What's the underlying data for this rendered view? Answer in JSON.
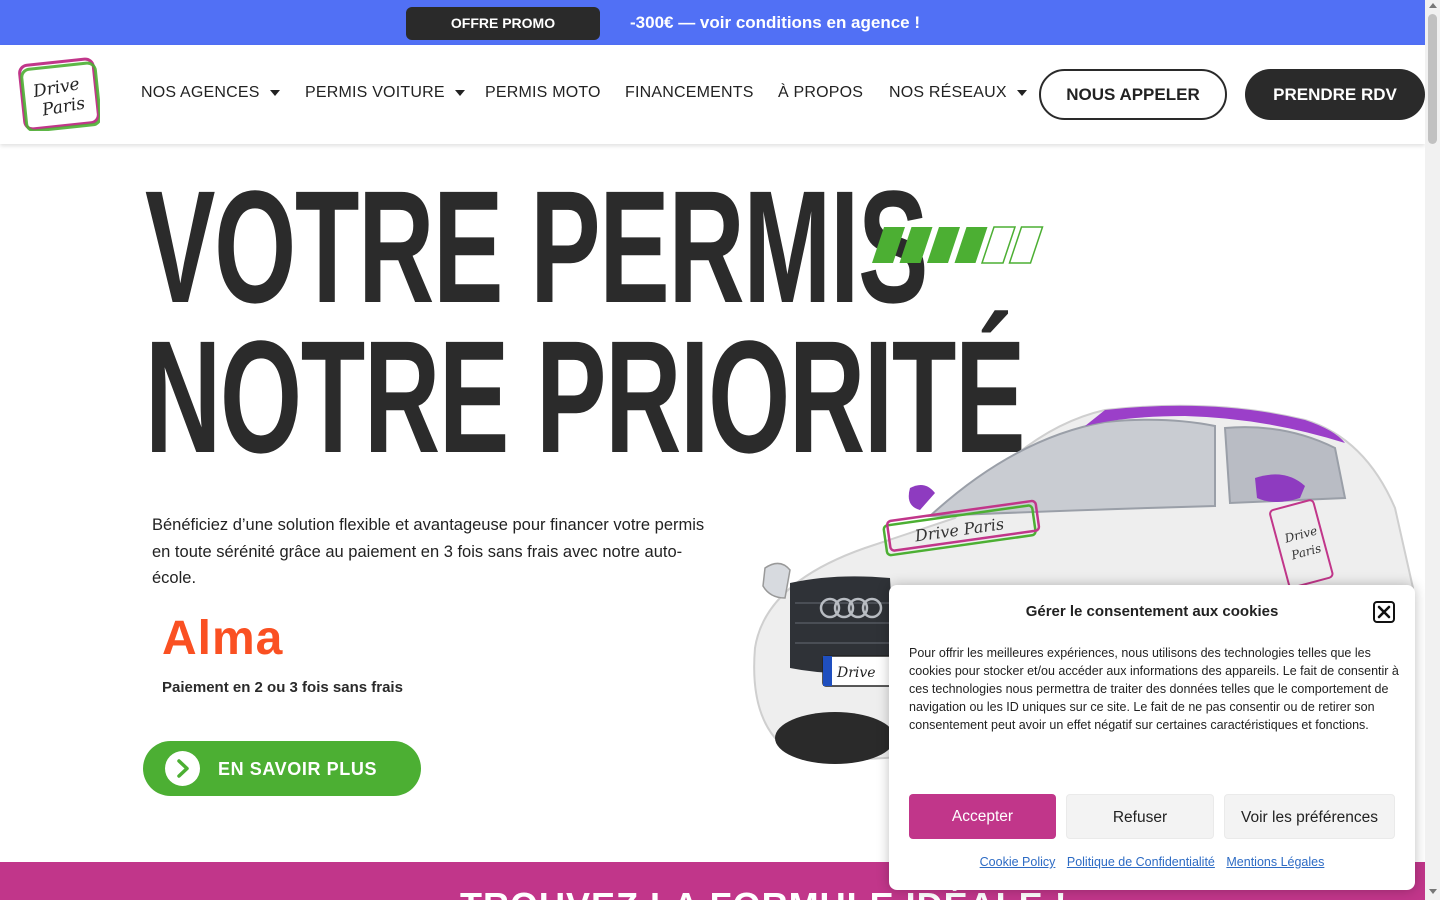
{
  "promo": {
    "badge": "OFFRE PROMO",
    "text": "-300€ — voir conditions en agence !"
  },
  "header": {
    "logo_text": "Drive Paris",
    "nav": [
      {
        "label": "NOS AGENCES",
        "has_dropdown": true
      },
      {
        "label": "PERMIS VOITURE",
        "has_dropdown": true
      },
      {
        "label": "PERMIS MOTO",
        "has_dropdown": false
      },
      {
        "label": "FINANCEMENTS",
        "has_dropdown": false
      },
      {
        "label": "À PROPOS",
        "has_dropdown": false
      },
      {
        "label": "NOS RÉSEAUX",
        "has_dropdown": true
      }
    ],
    "call_button": "NOUS APPELER",
    "rdv_button": "PRENDRE RDV"
  },
  "hero": {
    "title_line1": "VOTRE PERMIS",
    "title_line2": "NOTRE PRIORITÉ",
    "progress": {
      "filled": 4,
      "total": 6
    },
    "description": "Bénéficiez d’une solution flexible et avantageuse pour financer votre permis en toute sérénité grâce au paiement en 3 fois sans frais avec notre auto-école.",
    "alma_logo": "Alma",
    "alma_subtitle": "Paiement en 2 ou 3 fois sans frais",
    "cta_label": "EN SAVOIR PLUS",
    "car_plate_text": "Drive"
  },
  "band": {
    "title": "TROUVEZ LA FORMULE IDÉALE !"
  },
  "cookie": {
    "title": "Gérer le consentement aux cookies",
    "body": "Pour offrir les meilleures expériences, nous utilisons des technologies telles que les cookies pour stocker et/ou accéder aux informations des appareils. Le fait de consentir à ces technologies nous permettra de traiter des données telles que le comportement de navigation ou les ID uniques sur ce site. Le fait de ne pas consentir ou de retirer son consentement peut avoir un effet négatif sur certaines caractéristiques et fonctions.",
    "accept": "Accepter",
    "refuse": "Refuser",
    "preferences": "Voir les préférences",
    "links": [
      "Cookie Policy",
      "Politique de Confidentialité",
      "Mentions Légales"
    ]
  },
  "colors": {
    "promo_blue": "#5170f5",
    "dark": "#2a2a2a",
    "green": "#4caf33",
    "magenta": "#c1368a",
    "alma_orange": "#fa5022",
    "link_blue": "#2d6bc4"
  }
}
